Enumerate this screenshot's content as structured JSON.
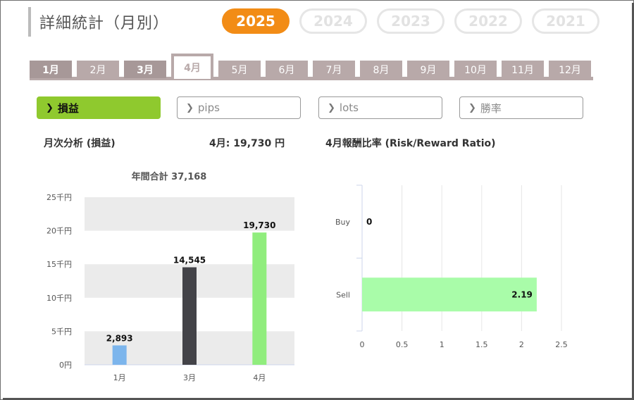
{
  "header": {
    "title": "詳細統計（月別）",
    "years": [
      {
        "label": "2025",
        "active": true
      },
      {
        "label": "2024",
        "active": false
      },
      {
        "label": "2023",
        "active": false
      },
      {
        "label": "2022",
        "active": false
      },
      {
        "label": "2021",
        "active": false
      }
    ]
  },
  "months": [
    {
      "label": "1月",
      "state": "dark"
    },
    {
      "label": "2月",
      "state": "normal"
    },
    {
      "label": "3月",
      "state": "dark"
    },
    {
      "label": "4月",
      "state": "active"
    },
    {
      "label": "5月",
      "state": "normal"
    },
    {
      "label": "6月",
      "state": "normal"
    },
    {
      "label": "7月",
      "state": "normal"
    },
    {
      "label": "8月",
      "state": "normal"
    },
    {
      "label": "9月",
      "state": "normal"
    },
    {
      "label": "10月",
      "state": "normal"
    },
    {
      "label": "11月",
      "state": "normal"
    },
    {
      "label": "12月",
      "state": "normal"
    }
  ],
  "metrics": [
    {
      "label": "損益",
      "active": true
    },
    {
      "label": "pips",
      "active": false
    },
    {
      "label": "lots",
      "active": false
    },
    {
      "label": "勝率",
      "active": false
    }
  ],
  "labels": {
    "monthly_analysis": "月次分析 (損益)",
    "month_value": "4月:  19,730 円",
    "ratio_title": "4月報酬比率 (Risk/Reward Ratio)"
  },
  "colors": {
    "accent_year": "#f28c16",
    "accent_metric": "#8fc92e",
    "tab": "#b8a9a9"
  },
  "chart_data": [
    {
      "type": "bar",
      "title": "年間合計 37,168",
      "categories": [
        "1月",
        "3月",
        "4月"
      ],
      "values": [
        2893,
        14545,
        19730
      ],
      "value_labels": [
        "2,893",
        "14,545",
        "19,730"
      ],
      "colors": [
        "#7cb5ec",
        "#434348",
        "#90ed7d"
      ],
      "ylim": [
        0,
        25000
      ],
      "yticks": [
        {
          "value": 0,
          "label": "0円"
        },
        {
          "value": 5000,
          "label": "5千円"
        },
        {
          "value": 10000,
          "label": "10千円"
        },
        {
          "value": 15000,
          "label": "15千円"
        },
        {
          "value": 20000,
          "label": "20千円"
        },
        {
          "value": 25000,
          "label": "25千円"
        }
      ],
      "grid": "alternating bands"
    },
    {
      "type": "bar",
      "orientation": "horizontal",
      "categories": [
        "Buy",
        "Sell"
      ],
      "values": [
        0,
        2.19
      ],
      "value_labels": [
        "0",
        "2.19"
      ],
      "color": "#a9fca9",
      "xlim": [
        0,
        2.5
      ],
      "xticks": [
        {
          "value": 0,
          "label": "0"
        },
        {
          "value": 0.5,
          "label": "0.5"
        },
        {
          "value": 1,
          "label": "1"
        },
        {
          "value": 1.5,
          "label": "1.5"
        },
        {
          "value": 2,
          "label": "2"
        },
        {
          "value": 2.5,
          "label": "2.5"
        }
      ],
      "grid": "vertical lines"
    }
  ]
}
